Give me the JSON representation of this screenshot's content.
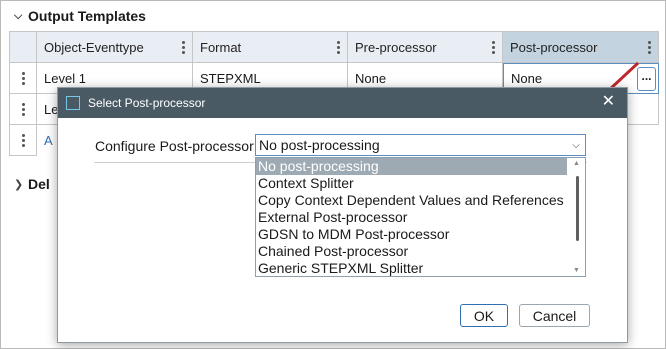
{
  "sections": {
    "output_templates": "Output Templates",
    "second_partial": "Del"
  },
  "grid": {
    "headers": [
      "Object-Eventtype",
      "Format",
      "Pre-processor",
      "Post-processor"
    ],
    "rows": [
      {
        "cells": [
          "Level 1",
          "STEPXML",
          "None",
          "None"
        ]
      },
      {
        "cells": [
          "Le",
          "",
          "",
          ""
        ]
      }
    ],
    "add_link": "A",
    "edit_button_label": "..."
  },
  "dialog": {
    "title": "Select Post-processor",
    "close_glyph": "✕",
    "config_label": "Configure Post-processor",
    "selected_value": "No post-processing",
    "options": [
      "No post-processing",
      "Context Splitter",
      "Copy Context Dependent Values and References",
      "External Post-processor",
      "GDSN to MDM Post-processor",
      "Chained Post-processor",
      "Generic STEPXML Splitter"
    ],
    "ok_label": "OK",
    "cancel_label": "Cancel"
  },
  "icons": {
    "section_chevron": "chevron-down-icon",
    "collapsed_chevron": "chevron-right-icon",
    "column_menu": "kebab-icon",
    "dialog_icon": "window-icon",
    "annotation": "arrow-annotation-icon"
  },
  "colors": {
    "titlebar": "#4a5a65",
    "header_active": "#c3d3df",
    "selected_option": "#9eaab3",
    "accent": "#2f6fb0",
    "arrow": "#c0262d"
  }
}
